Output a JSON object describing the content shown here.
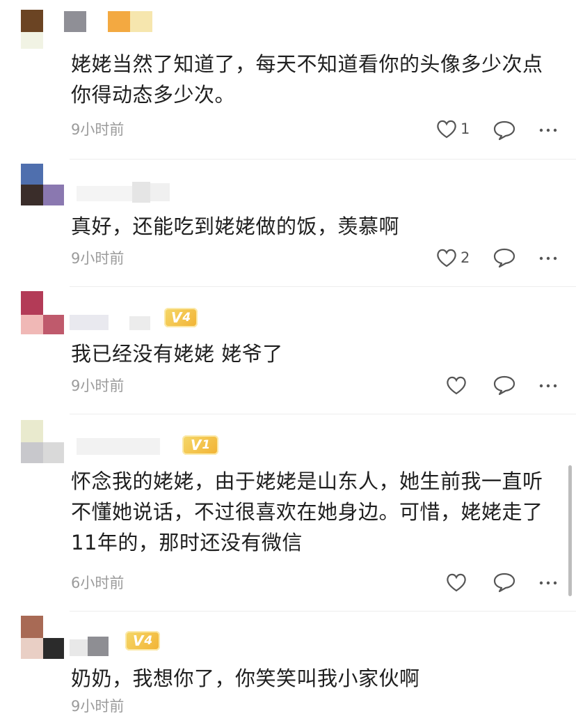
{
  "comments": [
    {
      "text": "姥姥当然了知道了，每天不知道看你的头像多少次点你得动态多少次。",
      "time": "9小时前",
      "likes": "1"
    },
    {
      "text": "真好，还能吃到姥姥做的饭，羡慕啊",
      "time": "9小时前",
      "likes": "2"
    },
    {
      "text": "我已经没有姥姥 姥爷了",
      "time": "9小时前",
      "likes": "",
      "badge": "4"
    },
    {
      "text": "怀念我的姥姥，由于姥姥是山东人，她生前我一直听不懂她说话，不过很喜欢在她身边。可惜，姥姥走了11年的，那时还没有微信",
      "time": "6小时前",
      "likes": "",
      "badge": "1"
    },
    {
      "text": "奶奶，我想你了，你笑笑叫我小家伙啊",
      "time": "9小时前",
      "likes": "",
      "badge": "4"
    }
  ],
  "icons": {
    "like": "heart-outline-icon",
    "reply": "speech-bubble-icon",
    "more": "more-dots-icon"
  },
  "colors": {
    "badge": "#f2b233",
    "time": "#9b9b9b",
    "divider": "#ededed"
  }
}
